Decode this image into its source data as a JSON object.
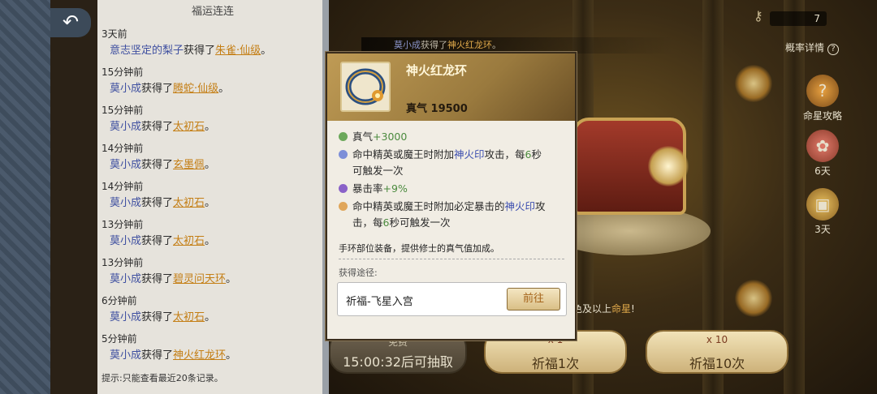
{
  "log": {
    "title": "福运连连",
    "entries": [
      {
        "time": "3天前",
        "who": "意志坚定的梨子",
        "verb": "获得了",
        "item": "朱雀·仙级",
        "end": "。"
      },
      {
        "time": "15分钟前",
        "who": "莫小成",
        "verb": "获得了",
        "item": "腾蛇·仙级",
        "end": "。"
      },
      {
        "time": "15分钟前",
        "who": "莫小成",
        "verb": "获得了",
        "item": "太初石",
        "end": "。"
      },
      {
        "time": "14分钟前",
        "who": "莫小成",
        "verb": "获得了",
        "item": "玄墨佩",
        "end": "。"
      },
      {
        "time": "14分钟前",
        "who": "莫小成",
        "verb": "获得了",
        "item": "太初石",
        "end": "。"
      },
      {
        "time": "13分钟前",
        "who": "莫小成",
        "verb": "获得了",
        "item": "太初石",
        "end": "。"
      },
      {
        "time": "13分钟前",
        "who": "莫小成",
        "verb": "获得了",
        "item": "碧灵问天环",
        "end": "。"
      },
      {
        "time": "6分钟前",
        "who": "莫小成",
        "verb": "获得了",
        "item": "太初石",
        "end": "。"
      },
      {
        "time": "5分钟前",
        "who": "莫小成",
        "verb": "获得了",
        "item": "神火红龙环",
        "end": "。"
      }
    ],
    "tip": "提示:只能查看最近20条记录。"
  },
  "notice": {
    "who": "莫小成",
    "verb": "获得了",
    "item": "神火红龙环",
    "end": "。"
  },
  "counter": {
    "value": "7",
    "icon": "key-icon"
  },
  "prob_details": {
    "label": "概率详情",
    "q": "?"
  },
  "side": {
    "strategy": {
      "label": "命星攻略",
      "icon": "question-orb-icon"
    },
    "gift6": {
      "label": "6天",
      "icon": "gift-bag-icon"
    },
    "chest3": {
      "label": "3天",
      "icon": "treasure-chest-icon"
    }
  },
  "gold_tip": {
    "text": "色及以上",
    "gold": "命星",
    "end": "!"
  },
  "buttons": {
    "free": {
      "top": "免费",
      "label": "15:00:32后可抽取"
    },
    "one": {
      "cost": "x 1",
      "label": "祈福1次"
    },
    "ten": {
      "cost": "x 10",
      "label": "祈福10次"
    }
  },
  "popup": {
    "name": "神火红龙环",
    "power": "真气 19500",
    "attr1": {
      "label": "真气",
      "value": "+3000",
      "color": "#6ba85a"
    },
    "attr2": {
      "pre": "命中精英或魔王时附加",
      "mark": "神火印",
      "mid": "攻击，每",
      "num": "6",
      "post": "秒",
      "line2": "可触发一次",
      "color": "#7d8fd8"
    },
    "attr3": {
      "label": "暴击率",
      "value": "+9%",
      "color": "#8a62c8"
    },
    "attr4": {
      "pre": "命中精英或魔王时附加必定暴击的",
      "mark": "神火印",
      "post": "攻",
      "line2a": "击，每",
      "num": "6",
      "line2b": "秒可触发一次",
      "color": "#e0a65a"
    },
    "desc": "手环部位装备，提供修士的真气值加成。",
    "source_label": "获得途径:",
    "source_name": "祈福-飞星入宫",
    "goto": "前往"
  }
}
